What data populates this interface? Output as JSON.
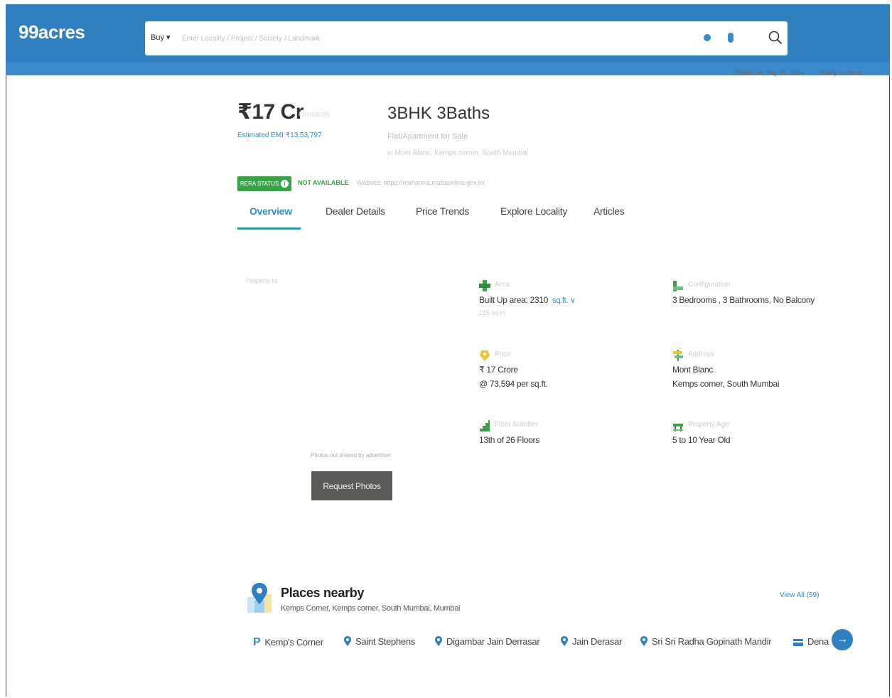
{
  "header": {
    "logo": "99acres",
    "search": {
      "buy_label": "Buy ▾",
      "placeholder": "Enter Locality / Project / Society / Landmark"
    }
  },
  "posted": {
    "date": "Posted on May 30, 2014",
    "status": "Ready to move"
  },
  "listing": {
    "price": "₹17 Cr",
    "price_note": "Onwards",
    "emi": "Estimated EMI ₹13,53,797",
    "bhk": "3BHK 3Baths",
    "type": "Flat/Apartment for Sale",
    "location": "in Mont Blanc, Kemps corner, South Mumbai",
    "rera_badge": "RERA STATUS",
    "rera_status": "NOT AVAILABLE",
    "website": "Website: https://maharera.mahaonline.gov.in/"
  },
  "tabs": [
    "Overview",
    "Dealer Details",
    "Price Trends",
    "Explore Locality",
    "Articles"
  ],
  "photos": {
    "placeholder": "Property Id",
    "hint": "Photos not shared by advertiser",
    "request_button": "Request Photos"
  },
  "details": {
    "area": {
      "label": "Area",
      "line1": "Built Up area: 2310",
      "unit": "sq.ft. ∨",
      "line2": "215 sq.m."
    },
    "config": {
      "label": "Configuration",
      "line1": "3 Bedrooms , 3 Bathrooms, No Balcony"
    },
    "price": {
      "label": "Price",
      "line1": "₹ 17 Crore",
      "line2": "@ 73,594 per sq.ft."
    },
    "address": {
      "label": "Address",
      "line1": "Mont Blanc",
      "line2": "Kemps corner, South Mumbai"
    },
    "floor": {
      "label": "Floor Number",
      "line1": "13th of 26 Floors"
    },
    "age": {
      "label": "Property Age",
      "line1": "5 to 10 Year Old"
    }
  },
  "places": {
    "title": "Places nearby",
    "subtitle": "Kemps Corner, Kemps corner, South Mumbai, Mumbai",
    "view_all": "View All (59)",
    "items": [
      "Kemp's Corner",
      "Saint Stephens",
      "Digambar Jain Derrasar",
      "Jain Derasar",
      "Sri Sri Radha Gopinath Mandir",
      "Dena"
    ],
    "next": "→"
  },
  "colors": {
    "brand": "#2f7fc1",
    "link": "#2f8fc5",
    "rera_green": "#3aa14a",
    "button_gray": "#5a5a56"
  }
}
